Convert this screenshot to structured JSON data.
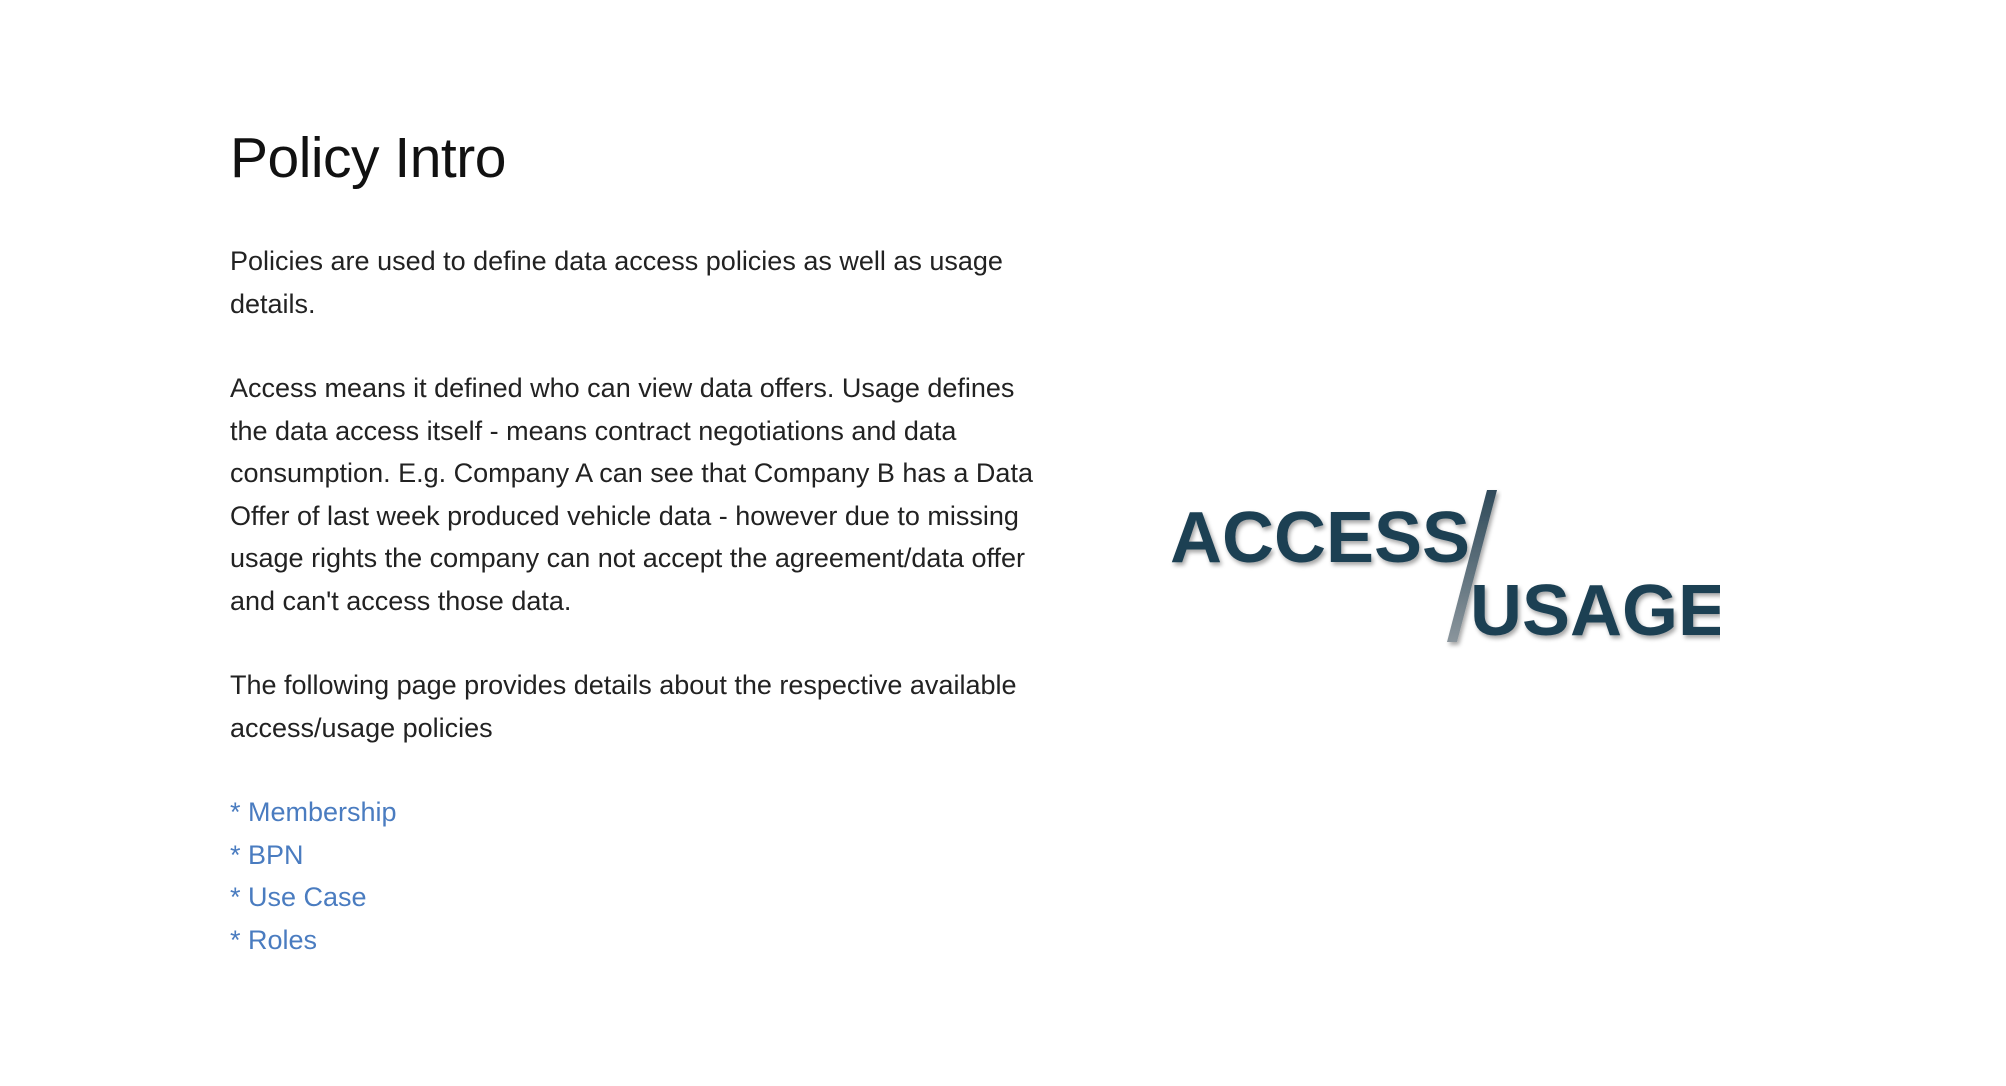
{
  "page": {
    "title": "Policy Intro",
    "paragraphs": [
      "Policies are used to define data access policies as well as usage details.",
      "Access means it defined who can view data offers. Usage defines the data access itself - means contract negotiations and data consumption. E.g. Company A can see that Company B has a Data Offer of last week produced vehicle data - however due to missing usage rights the company can not accept the agreement/data offer and can't access those data.",
      "The following page provides details about the respective available access/usage policies"
    ],
    "links": [
      "* Membership",
      "* BPN",
      "* Use Case",
      "* Roles"
    ]
  },
  "logo": {
    "word_top": "ACCESS",
    "word_bottom": "USAGE",
    "text_color": "#1e3f52",
    "slash_color": "#6b7a85"
  },
  "colors": {
    "link": "#4a7cc0",
    "text": "#222222",
    "background": "#ffffff"
  }
}
